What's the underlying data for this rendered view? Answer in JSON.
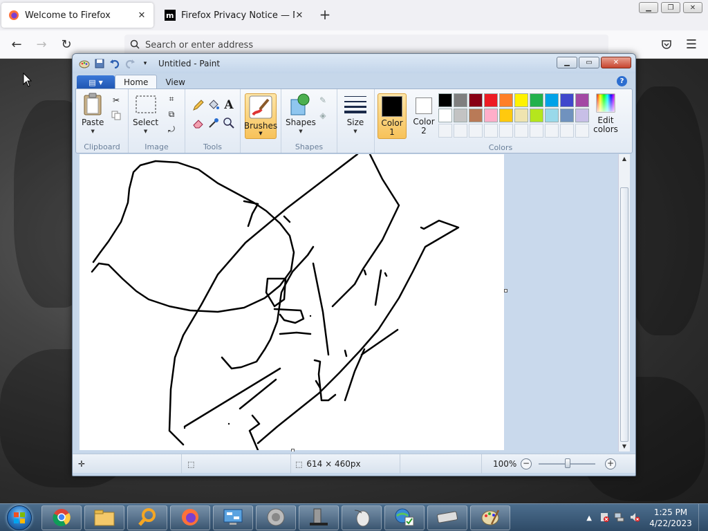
{
  "browser": {
    "tabs": [
      {
        "title": "Welcome to Firefox",
        "active": true
      },
      {
        "title": "Firefox Privacy Notice — Mozilla",
        "active": false
      }
    ],
    "new_tab": "+",
    "close_glyph": "✕",
    "address_placeholder": "Search or enter address"
  },
  "paint": {
    "title": "Untitled - Paint",
    "ribbon_tabs": [
      "Home",
      "View"
    ],
    "groups": {
      "clipboard": "Clipboard",
      "image": "Image",
      "tools": "Tools",
      "shapes": "Shapes",
      "colors": "Colors"
    },
    "buttons": {
      "paste": "Paste",
      "select": "Select",
      "brushes": "Brushes",
      "shapes": "Shapes",
      "size": "Size",
      "color1": "Color\n1",
      "color2": "Color\n2",
      "edit_colors": "Edit\ncolors"
    },
    "palette_row1": [
      "#000000",
      "#7f7f7f",
      "#880015",
      "#ed1c24",
      "#ff7f27",
      "#fff200",
      "#22b14c",
      "#00a2e8",
      "#3f48cc",
      "#a349a4"
    ],
    "palette_row2": [
      "#ffffff",
      "#c3c3c3",
      "#b97a57",
      "#ffaec9",
      "#ffc90e",
      "#efe4b0",
      "#b5e61d",
      "#99d9ea",
      "#7092be",
      "#c8bfe7"
    ],
    "color1_value": "#000000",
    "color2_value": "#ffffff",
    "status": {
      "dimensions": "614 × 460px",
      "zoom": "100%"
    }
  },
  "taskbar": {
    "time": "1:25 PM",
    "date": "4/22/2023"
  }
}
